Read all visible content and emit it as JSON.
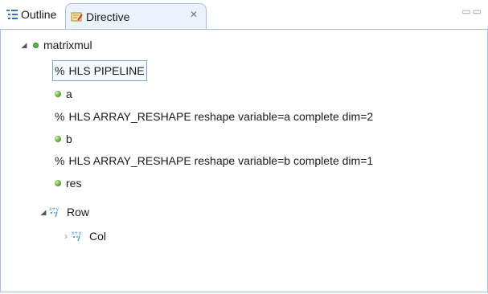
{
  "tabs": [
    {
      "label": "Outline",
      "icon": "outline-icon",
      "active": false
    },
    {
      "label": "Directive",
      "icon": "directive-icon",
      "active": true,
      "close": "✕"
    }
  ],
  "panel_controls": "▭▭",
  "tree": {
    "root": {
      "label": "matrixmul",
      "icon": "function-dot-icon",
      "expanded": true
    },
    "items": [
      {
        "label": "HLS PIPELINE",
        "prefix": "%",
        "type": "directive",
        "selected": true
      },
      {
        "label": "a",
        "type": "variable"
      },
      {
        "label": "HLS ARRAY_RESHAPE reshape variable=a complete dim=2",
        "prefix": "%",
        "type": "directive"
      },
      {
        "label": "b",
        "type": "variable"
      },
      {
        "label": "HLS ARRAY_RESHAPE reshape variable=b complete dim=1",
        "prefix": "%",
        "type": "directive"
      },
      {
        "label": "res",
        "type": "variable"
      },
      {
        "label": "Row",
        "type": "loop",
        "expanded": true
      },
      {
        "label": "Col",
        "type": "loop",
        "expanded": false
      }
    ]
  },
  "colors": {
    "tab_active_bg": "#eaf2fb",
    "border": "#a7bfd9",
    "selection_border": "#7da2ce",
    "variable_green": "#52b547",
    "loop_blue": "#3b8fd4"
  }
}
